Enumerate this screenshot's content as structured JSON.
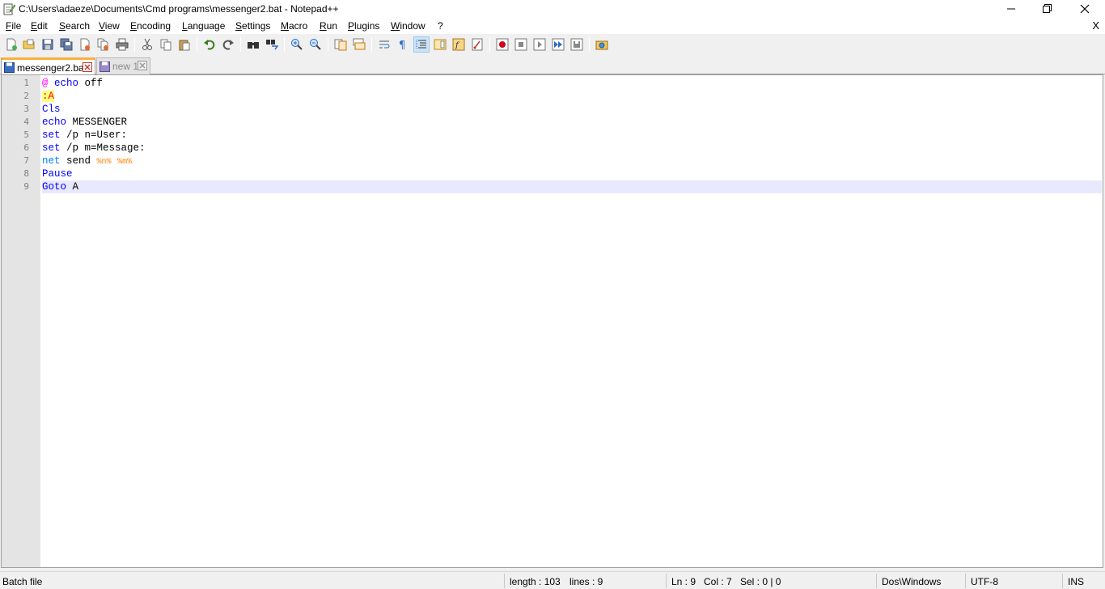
{
  "window": {
    "title": "C:\\Users\\adaeze\\Documents\\Cmd programs\\messenger2.bat - Notepad++"
  },
  "menu": {
    "items": [
      "File",
      "Edit",
      "Search",
      "View",
      "Encoding",
      "Language",
      "Settings",
      "Macro",
      "Run",
      "Plugins",
      "Window",
      "?"
    ],
    "close_label": "X"
  },
  "toolbar": {
    "icons": [
      "new-file-icon",
      "open-file-icon",
      "save-icon",
      "save-all-icon",
      "close-icon",
      "close-all-icon",
      "print-icon",
      "cut-icon",
      "copy-icon",
      "paste-icon",
      "undo-icon",
      "redo-icon",
      "find-icon",
      "replace-icon",
      "zoom-in-icon",
      "zoom-out-icon",
      "sync-vertical-icon",
      "sync-horizontal-icon",
      "word-wrap-icon",
      "show-all-chars-icon",
      "indent-guide-icon",
      "document-map-icon",
      "function-list-icon",
      "folder-as-workspace-icon",
      "record-macro-icon",
      "stop-macro-icon",
      "play-macro-icon",
      "run-macro-multiple-icon",
      "save-macro-icon",
      "launch-browser-icon"
    ]
  },
  "tabs": [
    {
      "label": "messenger2.bat",
      "active": true
    },
    {
      "label": "new 1",
      "active": false
    }
  ],
  "editor": {
    "line_numbers": [
      "1",
      "2",
      "3",
      "4",
      "5",
      "6",
      "7",
      "8",
      "9"
    ],
    "lines": {
      "l1": {
        "at": "@",
        "kw": "echo",
        "rest": " off"
      },
      "l2": {
        "label": ":A"
      },
      "l3": {
        "kw": "Cls"
      },
      "l4": {
        "kw": "echo",
        "rest": " MESSENGER"
      },
      "l5": {
        "kw": "set",
        "rest": " /p n=User:"
      },
      "l6": {
        "kw": "set",
        "rest": " /p m=Message:"
      },
      "l7": {
        "ext": "net",
        "rest": " send ",
        "var1": "%n%",
        "space": " ",
        "var2": "%m%"
      },
      "l8": {
        "kw": "Pause"
      },
      "l9": {
        "kw": "Goto",
        "rest": " A"
      }
    },
    "current_line": 9
  },
  "status": {
    "file_type": "Batch file",
    "length": "length : 103",
    "lines": "lines : 9",
    "ln": "Ln : 9",
    "col": "Col : 7",
    "sel": "Sel : 0 | 0",
    "eol": "Dos\\Windows",
    "encoding": "UTF-8",
    "mode": "INS"
  },
  "colors": {
    "keyword": "#0000ff",
    "at_sign": "#ff00ff",
    "label": "#ff0000",
    "label_bg": "#ffff80",
    "external_cmd": "#0080ff",
    "variable": "#ff8000",
    "current_line_bg": "#e8e8ff",
    "active_tab_accent": "#fab03b"
  }
}
